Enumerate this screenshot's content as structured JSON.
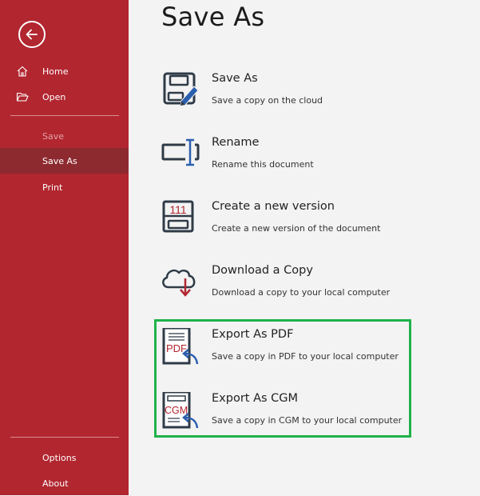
{
  "sidebar": {
    "back_label": "Back",
    "items": [
      {
        "label": "Home"
      },
      {
        "label": "Open"
      },
      {
        "label": "Save"
      },
      {
        "label": "Save As"
      },
      {
        "label": "Print"
      }
    ],
    "bottom_items": [
      {
        "label": "Options"
      },
      {
        "label": "About"
      }
    ]
  },
  "main": {
    "title": "Save As",
    "options": [
      {
        "title": "Save As",
        "description": "Save a copy on the cloud",
        "icon": "save-edit-icon"
      },
      {
        "title": "Rename",
        "description": "Rename this document",
        "icon": "rename-icon"
      },
      {
        "title": "Create a new version",
        "description": "Create a new version of the document",
        "icon": "version-icon"
      },
      {
        "title": "Download a Copy",
        "description": "Download a copy to your local computer",
        "icon": "cloud-download-icon"
      },
      {
        "title": "Export As PDF",
        "description": "Save a copy in PDF to your local computer",
        "icon": "pdf-export-icon",
        "icon_text": "PDF"
      },
      {
        "title": "Export As CGM",
        "description": "Save a copy in CGM to your local computer",
        "icon": "cgm-export-icon",
        "icon_text": "CGM"
      }
    ],
    "version_icon_text": "111"
  },
  "colors": {
    "sidebar": "#b1262f",
    "sidebar_active": "#8d2a30",
    "icon_dark": "#2f3b47",
    "icon_blue": "#2b5fae",
    "icon_red": "#b1262f",
    "highlight": "#1fb24a"
  }
}
